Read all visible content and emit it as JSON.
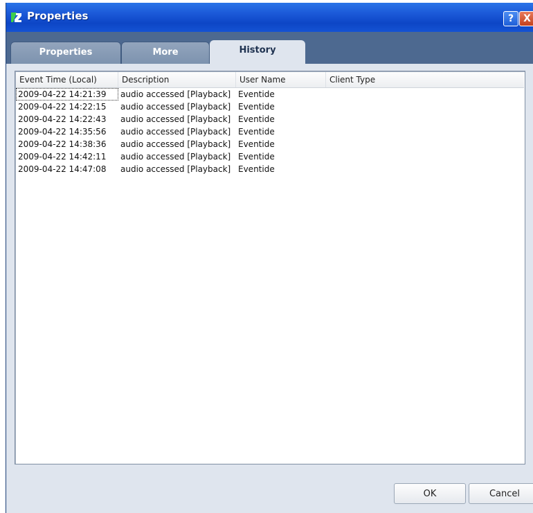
{
  "window": {
    "title": "Properties",
    "help_symbol": "?",
    "close_symbol": "X"
  },
  "tabs": [
    {
      "label": "Properties",
      "active": false
    },
    {
      "label": "More",
      "active": false
    },
    {
      "label": "History",
      "active": true
    }
  ],
  "history": {
    "columns": [
      "Event Time (Local)",
      "Description",
      "User Name",
      "Client Type"
    ],
    "rows": [
      [
        "2009-04-22 14:21:39",
        "audio accessed [Playback]",
        "Eventide",
        ""
      ],
      [
        "2009-04-22 14:22:15",
        "audio accessed [Playback]",
        "Eventide",
        ""
      ],
      [
        "2009-04-22 14:22:43",
        "audio accessed [Playback]",
        "Eventide",
        ""
      ],
      [
        "2009-04-22 14:35:56",
        "audio accessed [Playback]",
        "Eventide",
        ""
      ],
      [
        "2009-04-22 14:38:36",
        "audio accessed [Playback]",
        "Eventide",
        ""
      ],
      [
        "2009-04-22 14:42:11",
        "audio accessed [Playback]",
        "Eventide",
        ""
      ],
      [
        "2009-04-22 14:47:08",
        "audio accessed [Playback]",
        "Eventide",
        ""
      ]
    ]
  },
  "buttons": {
    "ok_label": "OK",
    "cancel_label": "Cancel"
  },
  "colors": {
    "titlebar": "#1c5ad9",
    "tab_area": "#4d6990",
    "panel": "#dfe5ee"
  }
}
